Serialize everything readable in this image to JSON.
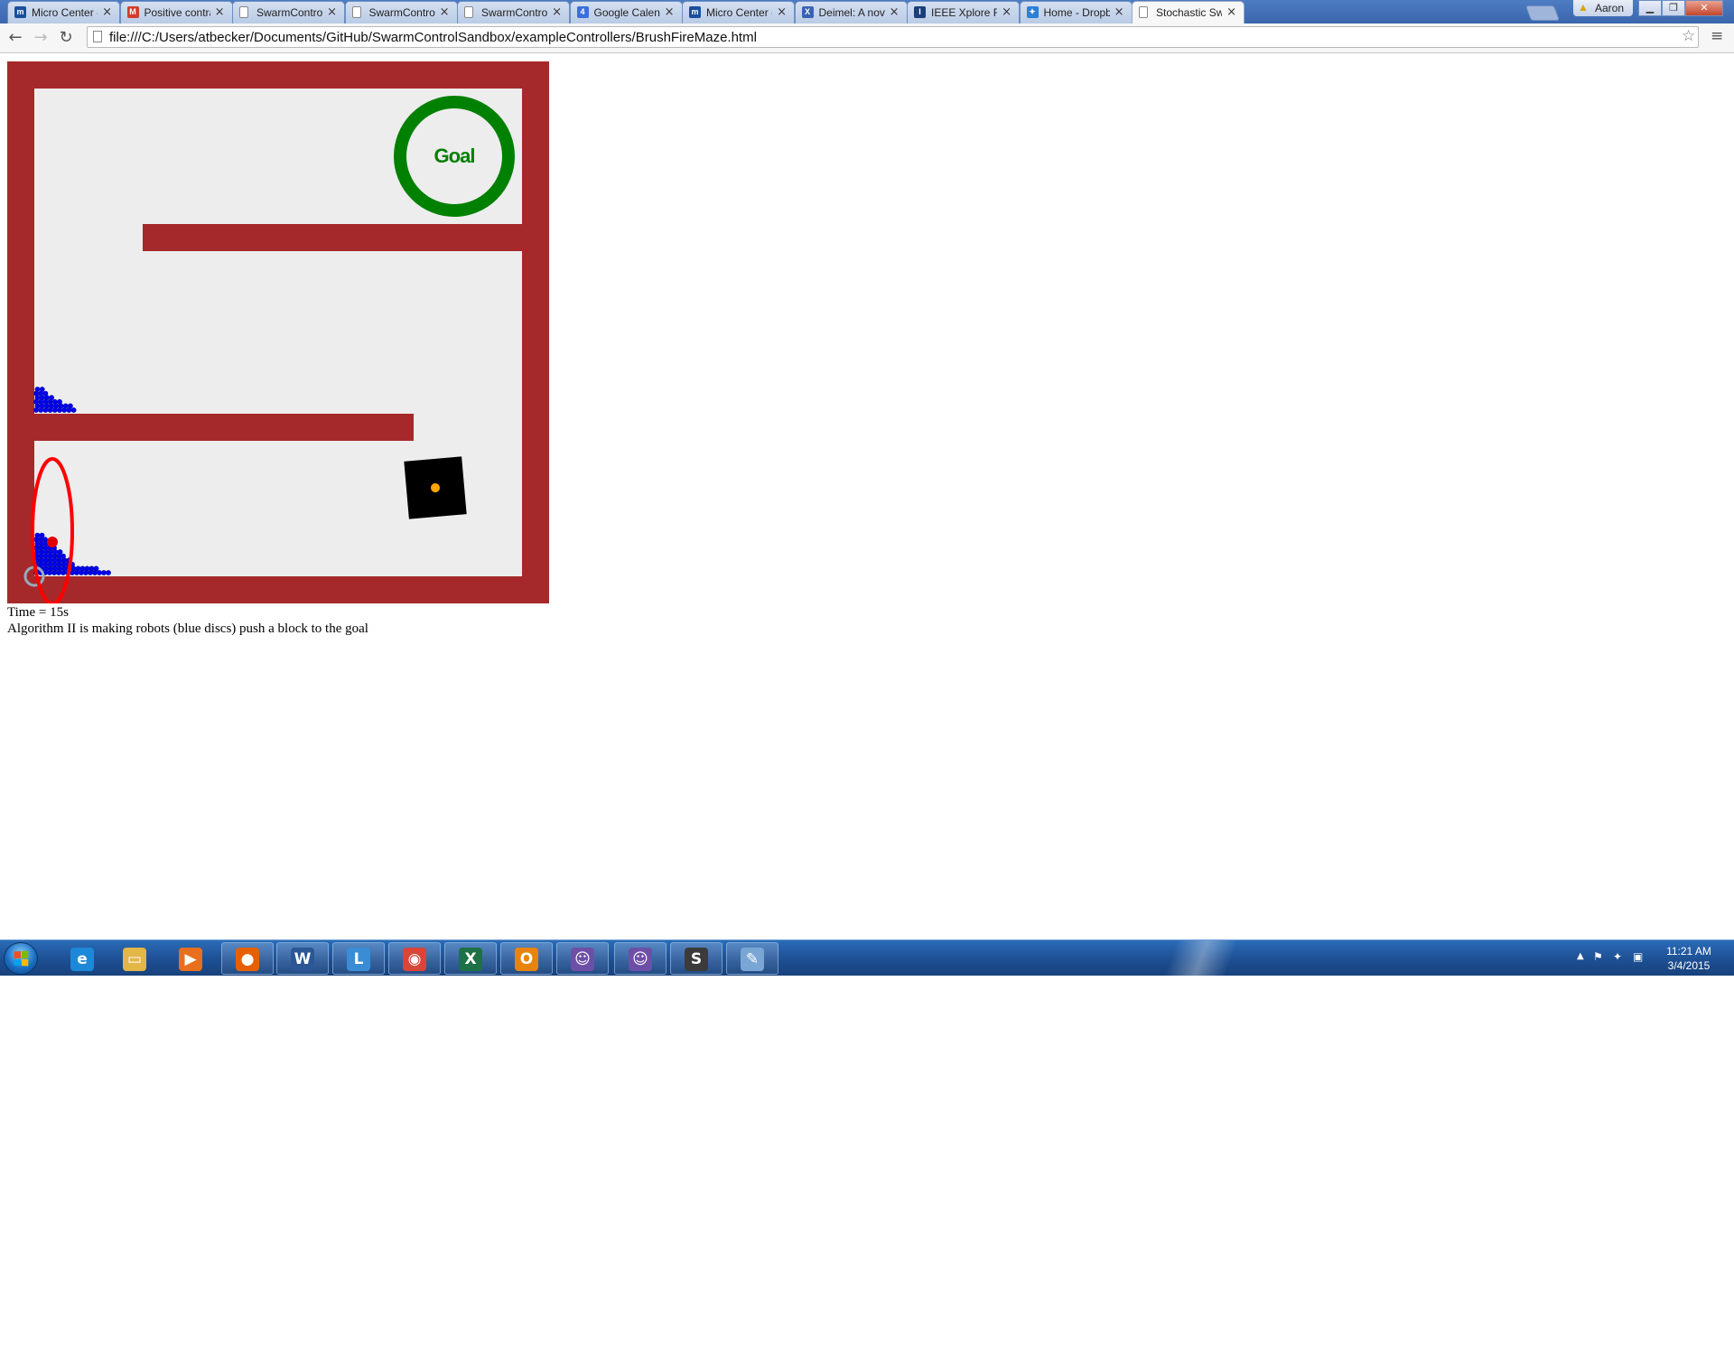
{
  "browser": {
    "tabs": [
      {
        "title": "Micro Center - Co",
        "favicon": "microcenter-icon",
        "favicon_color": "#1b4f9c",
        "favicon_glyph": "m"
      },
      {
        "title": "Positive contrast M",
        "favicon": "gmail-icon",
        "favicon_color": "#d23d2c",
        "favicon_glyph": "M"
      },
      {
        "title": "SwarmControlWit",
        "favicon": "page-icon",
        "favicon_color": "",
        "favicon_glyph": ""
      },
      {
        "title": "SwarmControlWit",
        "favicon": "page-icon",
        "favicon_color": "",
        "favicon_glyph": ""
      },
      {
        "title": "SwarmControlWit",
        "favicon": "page-icon",
        "favicon_color": "",
        "favicon_glyph": ""
      },
      {
        "title": "Google Calendar",
        "favicon": "calendar-icon",
        "favicon_color": "#3b6fd9",
        "favicon_glyph": "4"
      },
      {
        "title": "Micro Center - Co",
        "favicon": "microcenter-icon",
        "favicon_color": "#1b4f9c",
        "favicon_glyph": "m"
      },
      {
        "title": "Deimel: A novel ty",
        "favicon": "journal-icon",
        "favicon_color": "#3a62b3",
        "favicon_glyph": "X"
      },
      {
        "title": "IEEE Xplore Full-Te",
        "favicon": "ieee-icon",
        "favicon_color": "#1a3f7a",
        "favicon_glyph": "I"
      },
      {
        "title": "Home - Dropbox",
        "favicon": "dropbox-icon",
        "favicon_color": "#2a7fd6",
        "favicon_glyph": "✦"
      },
      {
        "title": "Stochastic Swarm",
        "favicon": "page-icon",
        "favicon_color": "",
        "favicon_glyph": "",
        "active": true
      }
    ],
    "tab_close_glyph": "×",
    "profile_name": "Aaron",
    "url": "file:///C:/Users/atbecker/Documents/GitHub/SwarmControlSandbox/exampleControllers/BrushFireMaze.html"
  },
  "page": {
    "goal_label": "Goal",
    "time_line": "Time = 15s",
    "description": "Algorithm II is making robots (blue discs) push a block to the goal",
    "colors": {
      "wall": "#a5292a",
      "floor": "#ededed",
      "goal": "#008000",
      "robot": "#0000ee",
      "block": "#000000",
      "block_center": "#ffa500",
      "ellipse": "#ff0000",
      "marker": "#e00000"
    }
  },
  "taskbar": {
    "apps": [
      {
        "name": "internet-explorer-icon",
        "glyph": "e",
        "color": "#1e88d8",
        "pinned": true
      },
      {
        "name": "file-explorer-icon",
        "glyph": "▭",
        "color": "#e3b648",
        "pinned": true
      },
      {
        "name": "media-player-icon",
        "glyph": "▶",
        "color": "#e86f1d",
        "pinned": true
      },
      {
        "name": "firefox-icon",
        "glyph": "●",
        "color": "#e66000",
        "pinned": false
      },
      {
        "name": "word-icon",
        "glyph": "W",
        "color": "#2b5797",
        "pinned": false
      },
      {
        "name": "lync-icon",
        "glyph": "L",
        "color": "#3a8dd4",
        "pinned": false
      },
      {
        "name": "chrome-icon",
        "glyph": "◉",
        "color": "#db4437",
        "pinned": false
      },
      {
        "name": "excel-icon",
        "glyph": "X",
        "color": "#1e7145",
        "pinned": false
      },
      {
        "name": "outlook-icon",
        "glyph": "O",
        "color": "#e8840c",
        "pinned": false
      },
      {
        "name": "github-icon",
        "glyph": "☺",
        "color": "#6e4fa7",
        "pinned": false
      },
      {
        "name": "github-icon-2",
        "glyph": "☺",
        "color": "#6e4fa7",
        "pinned": false
      },
      {
        "name": "sublime-text-icon",
        "glyph": "S",
        "color": "#3b3b3b",
        "pinned": false
      },
      {
        "name": "paint-icon",
        "glyph": "✎",
        "color": "#7aa6d6",
        "pinned": false
      }
    ],
    "clock_time": "11:21 AM",
    "clock_date": "3/4/2015"
  }
}
